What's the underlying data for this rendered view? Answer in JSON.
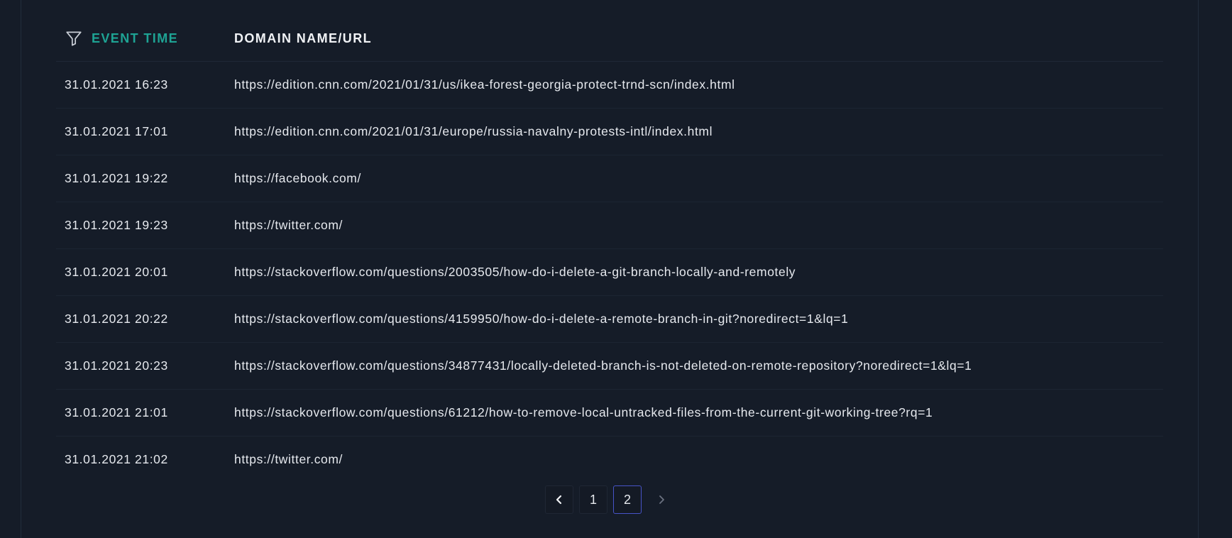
{
  "table": {
    "columns": {
      "time": "EVENT TIME",
      "url": "DOMAIN NAME/URL"
    },
    "rows": [
      {
        "time": "31.01.2021 16:23",
        "url": "https://edition.cnn.com/2021/01/31/us/ikea-forest-georgia-protect-trnd-scn/index.html"
      },
      {
        "time": "31.01.2021 17:01",
        "url": "https://edition.cnn.com/2021/01/31/europe/russia-navalny-protests-intl/index.html"
      },
      {
        "time": "31.01.2021 19:22",
        "url": "https://facebook.com/"
      },
      {
        "time": "31.01.2021 19:23",
        "url": "https://twitter.com/"
      },
      {
        "time": "31.01.2021 20:01",
        "url": "https://stackoverflow.com/questions/2003505/how-do-i-delete-a-git-branch-locally-and-remotely"
      },
      {
        "time": "31.01.2021 20:22",
        "url": "https://stackoverflow.com/questions/4159950/how-do-i-delete-a-remote-branch-in-git?noredirect=1&lq=1"
      },
      {
        "time": "31.01.2021 20:23",
        "url": "https://stackoverflow.com/questions/34877431/locally-deleted-branch-is-not-deleted-on-remote-repository?noredirect=1&lq=1"
      },
      {
        "time": "31.01.2021 21:01",
        "url": "https://stackoverflow.com/questions/61212/how-to-remove-local-untracked-files-from-the-current-git-working-tree?rq=1"
      },
      {
        "time": "31.01.2021 21:02",
        "url": "https://twitter.com/"
      }
    ]
  },
  "pagination": {
    "pages": [
      "1",
      "2"
    ],
    "current": "2"
  },
  "icons": {
    "filter": "filter-icon",
    "prev": "chevron-left-icon",
    "next": "chevron-right-icon"
  },
  "colors": {
    "background": "#151c28",
    "accent": "#1ea394",
    "active_page_border": "#4754c8",
    "text": "#e6e9ee"
  }
}
